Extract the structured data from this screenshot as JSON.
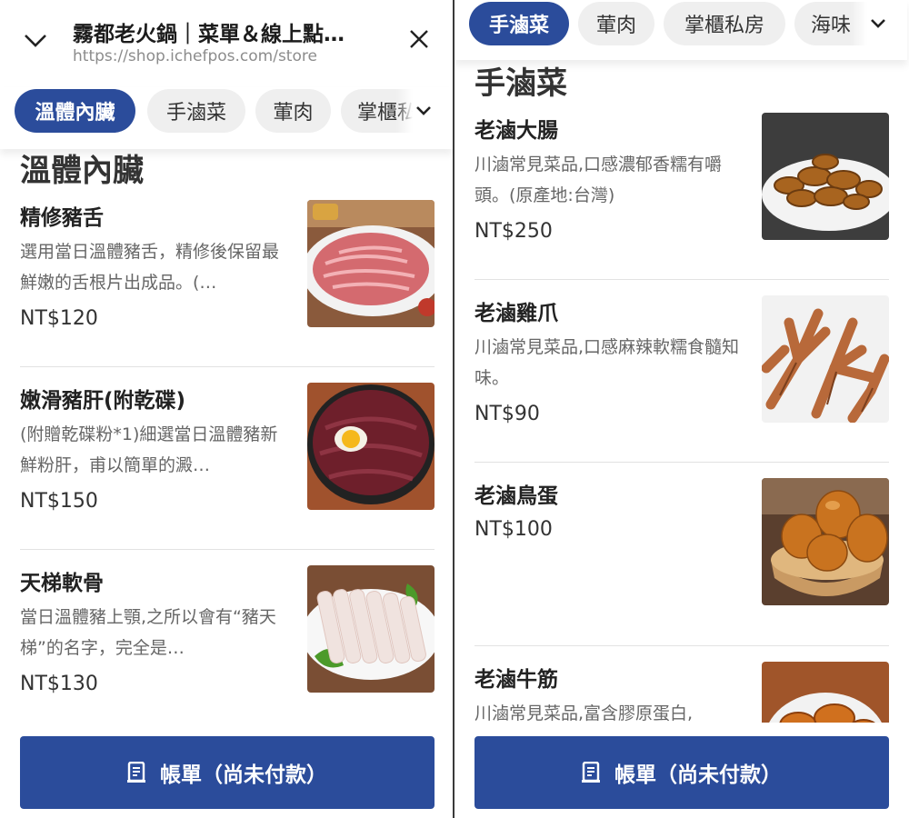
{
  "left": {
    "store_title": "霧都老火鍋｜菜單＆線上點…",
    "store_url": "https://shop.ichefpos.com/store",
    "chips": [
      "溫體內臟",
      "手滷菜",
      "葷肉",
      "掌櫃私"
    ],
    "active_chip": 0,
    "section_title": "溫體內臟",
    "items": [
      {
        "name": "精修豬舌",
        "desc": "選用當日溫體豬舌，精修後保留最鮮嫩的舌根片出成品。(…",
        "price": "NT$120",
        "image": "sliced-pork-tongue-photo"
      },
      {
        "name": "嫩滑豬肝(附乾碟)",
        "desc": "(附贈乾碟粉*1)細選當日溫體豬新鮮粉肝，甫以簡單的澱…",
        "price": "NT$150",
        "image": "raw-pork-liver-with-egg-yolk-photo"
      },
      {
        "name": "天梯軟骨",
        "desc": "當日溫體豬上顎,之所以會有“豬天梯”的名字，完全是…",
        "price": "NT$130",
        "image": "pork-palate-cartilage-slices-photo"
      }
    ],
    "bill_label": "帳單（尚未付款）",
    "bill_icon": "receipt-icon"
  },
  "right": {
    "chips": [
      "手滷菜",
      "葷肉",
      "掌櫃私房",
      "海味"
    ],
    "active_chip": 0,
    "section_title": "手滷菜",
    "items": [
      {
        "name": "老滷大腸",
        "desc": "川滷常見菜品,口感濃郁香糯有嚼頭。(原產地:台灣)",
        "price": "NT$250",
        "image": "braised-intestines-photo"
      },
      {
        "name": "老滷雞爪",
        "desc": "川滷常見菜品,口感麻辣軟糯食髓知味。",
        "price": "NT$90",
        "image": "braised-chicken-feet-photo"
      },
      {
        "name": "老滷鳥蛋",
        "desc": "",
        "price": "NT$100",
        "image": "braised-quail-eggs-photo"
      },
      {
        "name": "老滷牛筋",
        "desc": "川滷常見菜品,富含膠原蛋白,",
        "price": "",
        "image": "braised-beef-tendon-photo"
      }
    ],
    "bill_label": "帳單（尚未付款）",
    "bill_icon": "receipt-icon"
  },
  "colors": {
    "primary": "#2b4c9b",
    "chip_bg": "#efefef",
    "divider": "#e2e2e2",
    "muted_text": "#666666"
  }
}
